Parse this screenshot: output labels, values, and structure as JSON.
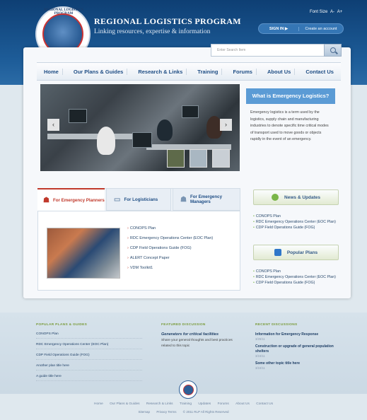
{
  "site": {
    "title": "REGIONAL LOGISTICS PROGRAM",
    "tagline": "Linking resources, expertise & information",
    "logo_text": "REGIONAL LOGISTICS PROGRAM"
  },
  "font_size": {
    "label": "Font Size",
    "smaller": "A-",
    "larger": "A+"
  },
  "auth": {
    "sign_in": "SIGN IN ▶",
    "create_account": "Create an account"
  },
  "search": {
    "placeholder": "Enter Search Item"
  },
  "nav": [
    "Home",
    "Our Plans & Guides",
    "Research & Links",
    "Training",
    "Forums",
    "About Us",
    "Contact Us"
  ],
  "slider": {
    "prev": "‹",
    "next": "›"
  },
  "info_box": {
    "title": "What is Emergency Logistics?",
    "text": "Emergency logistics is a term used by the logistics, supply chain and manufacturing industries to denote specific time critical modes of transport used to move goods or objects rapidly in the event of an emergency."
  },
  "tabs": [
    {
      "label": "For Emergency Planners",
      "icon": "people-icon"
    },
    {
      "label": "For Logisticians",
      "icon": "laptop-icon"
    },
    {
      "label": "For Emergency Managers",
      "icon": "group-icon"
    }
  ],
  "tab_links": [
    "CONOPS Plan",
    "RDC Emergency Operations Center (EOC Plan)",
    "CDP Field Operations Guide (FOG)",
    "ALERT Concept Paper",
    "VDM Toolkit1"
  ],
  "news": {
    "title": "News & Updates",
    "items": [
      "CONOPS Plan",
      "RDC Emergency Operations Center (EOC Plan)",
      "CDP Field Operations Guide (FOG)"
    ]
  },
  "popular": {
    "title": "Popular Plans",
    "items": [
      "CONOPS Plan",
      "RDC Emergency Operations Center (EOC Plan)",
      "CDP Field Operations Guide (FOG)"
    ]
  },
  "footer": {
    "col1": {
      "heading": "POPULAR PLANS & GUIDES",
      "links": [
        "CONOPS Plan",
        "RDC Emergency Operations Center (EOC Plan)",
        "CDP Field Operations Guide (FOG)",
        "Another plan title here",
        "A guide title here"
      ]
    },
    "col2": {
      "heading": "FEATURED DISCUSSION",
      "title": "Generators for critical facilities",
      "text": "Share your general thoughts and best practices related to this topic"
    },
    "col3": {
      "heading": "RECENT DISCUSSIONS",
      "items": [
        {
          "title": "Information for Emergency Response",
          "date": "3/25/11"
        },
        {
          "title": "Construction or upgrade of general population shelters",
          "date": "3/24/11"
        },
        {
          "title": "Some other topic title here",
          "date": "3/24/11"
        }
      ]
    },
    "nav": [
      "Home",
      "Our Plans & Guides",
      "Research & Links",
      "Training",
      "Updates",
      "Forums",
      "About Us",
      "Contact Us"
    ],
    "bottom": [
      "Sitemap",
      "Privacy Terms",
      "© 2011 RLP All Rights Reserved"
    ]
  }
}
